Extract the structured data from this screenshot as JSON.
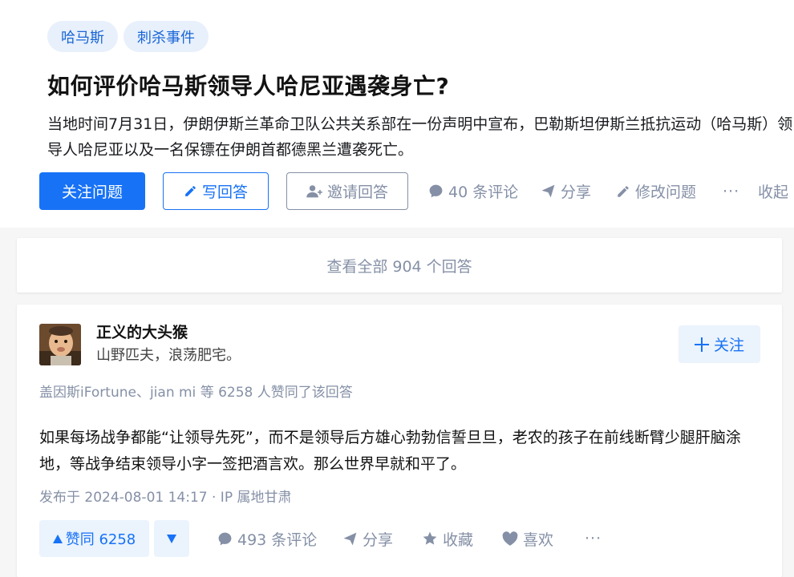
{
  "question": {
    "tags": [
      "哈马斯",
      "刺杀事件"
    ],
    "title": "如何评价哈马斯领导人哈尼亚遇袭身亡?",
    "description": "当地时间7月31日，伊朗伊斯兰革命卫队公共关系部在一份声明中宣布，巴勒斯坦伊斯兰抵抗运动（哈马斯）领导人哈尼亚以及一名保镖在伊朗首都德黑兰遭袭死亡。",
    "actions": {
      "follow_label": "关注问题",
      "write_label": "写回答",
      "invite_label": "邀请回答",
      "comments_label": "40 条评论",
      "share_label": "分享",
      "edit_label": "修改问题",
      "more_label": "···",
      "collapse_label": "收起"
    }
  },
  "view_all_label": "查看全部 904 个回答",
  "answer": {
    "author": {
      "name": "正义的大头猴",
      "bio": "山野匹夫，浪荡肥宅。",
      "follow_label": "关注"
    },
    "voters_text": "盖因斯iFortune、jian mi 等 6258 人赞同了该回答",
    "content": "如果每场战争都能“让领导先死”，而不是领导后方雄心勃勃信誓旦旦，老农的孩子在前线断臂少腿肝脑涂地，等战争结束领导小字一签把酒言欢。那么世界早就和平了。",
    "meta": "发布于 2024-08-01 14:17 · IP 属地甘肃",
    "actions": {
      "upvote_label": "赞同 6258",
      "comments_label": "493 条评论",
      "share_label": "分享",
      "collect_label": "收藏",
      "like_label": "喜欢",
      "more_label": "···"
    }
  },
  "colors": {
    "primary": "#1772f6",
    "primary_light": "#ebf3fd",
    "muted": "#8590a6"
  }
}
